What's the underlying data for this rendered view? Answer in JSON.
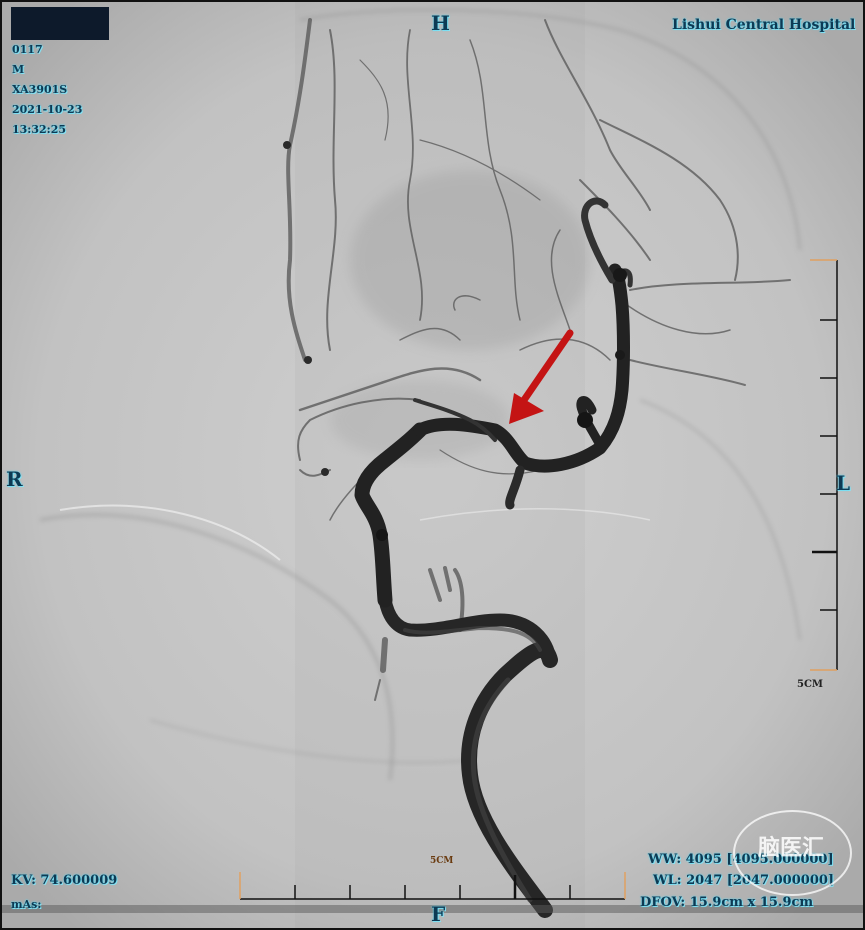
{
  "hospital_name": "Lishui Central Hospital",
  "patient": {
    "id": "0117",
    "sex": "M",
    "code": "XA3901S",
    "date": "2021-10-23",
    "time": "13:32:25"
  },
  "orientation": {
    "top": "H",
    "bottom": "F",
    "left": "R",
    "right": "L"
  },
  "acquisition": {
    "kv": "KV: 74.600009",
    "ma": "mAs:"
  },
  "window": {
    "ww": "WW: 4095 [4095.000000]",
    "wl": "WL: 2047 [2047.000000]",
    "fov": "DFOV: 15.9cm x 15.9cm"
  },
  "scale_labels": {
    "right": "5CM",
    "bottom": "5CM"
  },
  "watermark": "脑医汇",
  "colors": {
    "arrow": "#c41414",
    "overlay_text": "#0d3a54",
    "scale_tick": "#e0a060"
  }
}
